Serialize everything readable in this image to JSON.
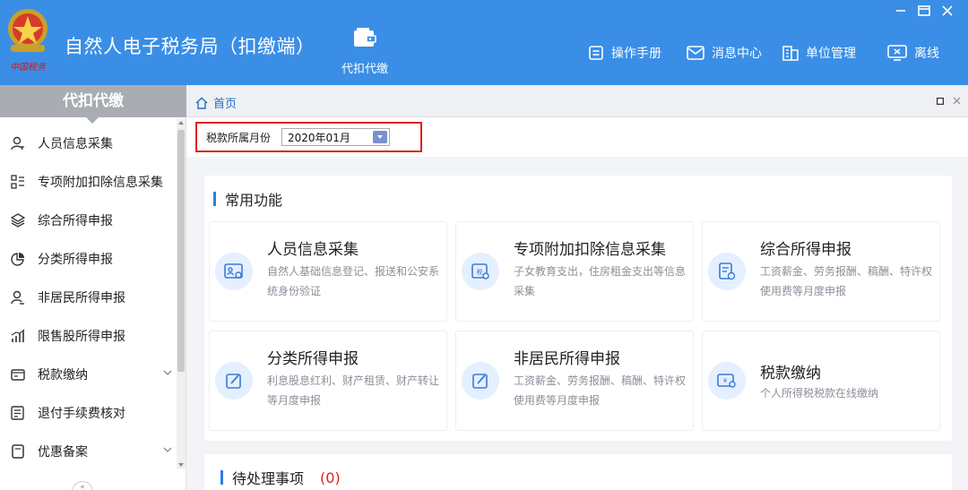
{
  "header": {
    "logo_text": "中国税务",
    "app_title": "自然人电子税务局（扣缴端）",
    "module_label": "代扣代缴",
    "buttons": [
      {
        "label": "操作手册",
        "icon": "manual-icon"
      },
      {
        "label": "消息中心",
        "icon": "mail-icon"
      },
      {
        "label": "单位管理",
        "icon": "building-icon"
      },
      {
        "label": "离线",
        "icon": "offline-icon"
      }
    ]
  },
  "sidebar": {
    "title": "代扣代缴",
    "items": [
      {
        "label": "人员信息采集",
        "icon": "person-icon"
      },
      {
        "label": "专项附加扣除信息采集",
        "icon": "list-icon"
      },
      {
        "label": "综合所得申报",
        "icon": "layers-icon"
      },
      {
        "label": "分类所得申报",
        "icon": "pie-icon"
      },
      {
        "label": "非居民所得申报",
        "icon": "person-alt-icon"
      },
      {
        "label": "限售股所得申报",
        "icon": "bar-chart-icon"
      },
      {
        "label": "税款缴纳",
        "icon": "wallet-icon",
        "expandable": true
      },
      {
        "label": "退付手续费核对",
        "icon": "checklist-icon"
      },
      {
        "label": "优惠备案",
        "icon": "document-icon",
        "expandable": true
      }
    ]
  },
  "tabs": {
    "home_label": "首页"
  },
  "filter": {
    "label": "税款所属月份",
    "month_value": "2020年01月"
  },
  "common": {
    "title": "常用功能",
    "cards": [
      {
        "title": "人员信息采集",
        "desc": "自然人基础信息登记、报送和公安系统身份验证",
        "icon": "id-card-icon"
      },
      {
        "title": "专项附加扣除信息采集",
        "desc": "子女教育支出，住房租金支出等信息采集",
        "icon": "tax-form-icon"
      },
      {
        "title": "综合所得申报",
        "desc": "工资薪金、劳务报酬、稿酬、特许权使用费等月度申报",
        "icon": "report-icon"
      },
      {
        "title": "分类所得申报",
        "desc": "利息股息红利、财产租赁、财产转让等月度申报",
        "icon": "edit-icon"
      },
      {
        "title": "非居民所得申报",
        "desc": "工资薪金、劳务报酬、稿酬、特许权使用费等月度申报",
        "icon": "edit-icon"
      },
      {
        "title": "税款缴纳",
        "desc": "个人所得税税款在线缴纳",
        "icon": "tax-pay-icon"
      }
    ]
  },
  "pending": {
    "title": "待处理事项",
    "count": "(0)"
  }
}
